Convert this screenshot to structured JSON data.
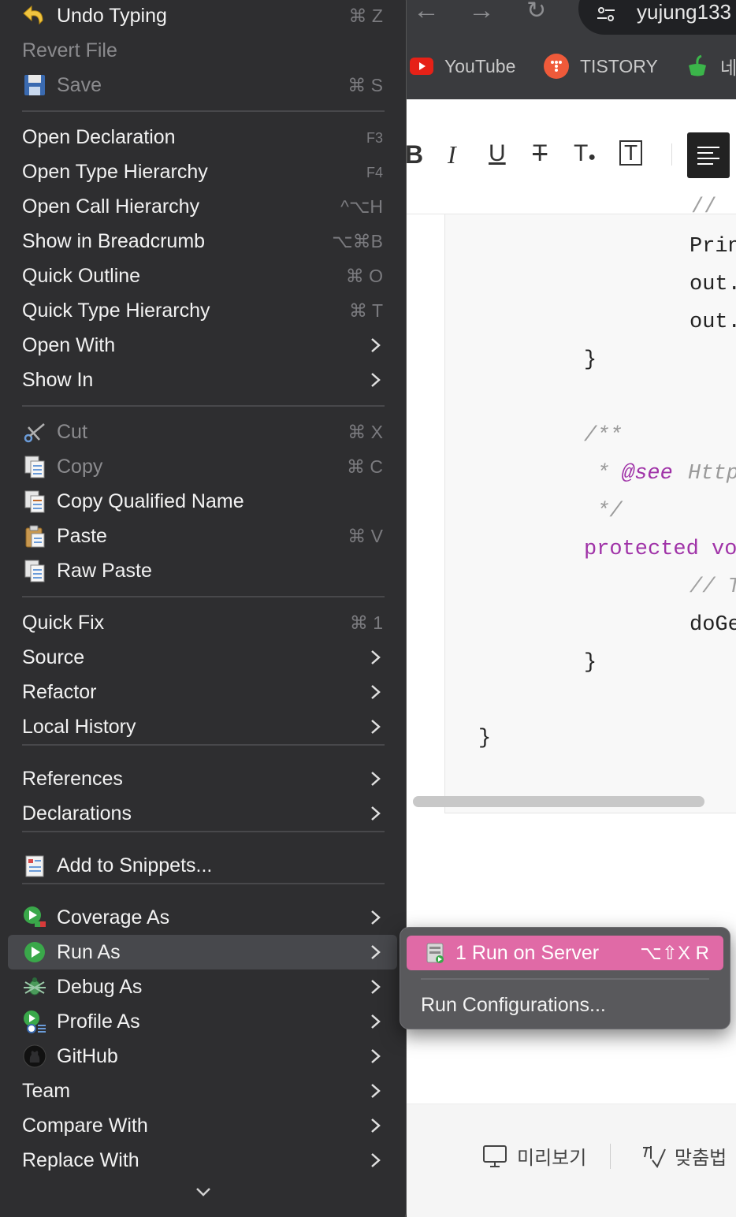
{
  "browser": {
    "url_text": "yujung133",
    "bookmarks": [
      {
        "label": "YouTube",
        "icon": "youtube-icon",
        "color": "#e62117"
      },
      {
        "label": "TISTORY",
        "icon": "tistory-icon",
        "color": "#ef5a3a"
      },
      {
        "label": "네",
        "icon": "naver-icon",
        "color": "#3bb54a"
      }
    ],
    "toolbar": [
      "B",
      "I",
      "U",
      "T",
      "T",
      "T"
    ],
    "code_lines": [
      {
        "text": "//",
        "color": "#a0a0a0"
      },
      {
        "text": "Prin",
        "color": "#222222"
      },
      {
        "text": "out.",
        "color": "#222222"
      },
      {
        "text": "out.",
        "color": "#222222"
      },
      {
        "text": "}",
        "color": "#222222"
      },
      {
        "text": "/**",
        "color": "#9a9a9a"
      },
      {
        "text": " * ",
        "color": "#9a9a9a"
      },
      {
        "text": "@see",
        "color": "#a033a8"
      },
      {
        "text": "Http",
        "color": "#9a9a9a"
      },
      {
        "text": " */",
        "color": "#9a9a9a"
      },
      {
        "text": "protected vo",
        "color": "#a033a8"
      },
      {
        "text": "// T",
        "color": "#a0a0a0"
      },
      {
        "text": "doGe",
        "color": "#222222"
      },
      {
        "text": "}",
        "color": "#222222"
      },
      {
        "text": "}",
        "color": "#222222"
      }
    ],
    "bottom_bar": {
      "preview": "미리보기",
      "spellcheck": "맞춤법"
    }
  },
  "menu": {
    "items": [
      {
        "label": "Undo Typing",
        "shortcut": "⌘ Z",
        "icon": "undo-icon",
        "disabled": false
      },
      {
        "label": "Revert File",
        "shortcut": "",
        "icon": "",
        "disabled": true
      },
      {
        "label": "Save",
        "shortcut": "⌘ S",
        "icon": "save-icon",
        "disabled": true
      },
      {
        "label": "Open Declaration",
        "shortcut": "F3",
        "icon": "",
        "disabled": false
      },
      {
        "label": "Open Type Hierarchy",
        "shortcut": "F4",
        "icon": "",
        "disabled": false
      },
      {
        "label": "Open Call Hierarchy",
        "shortcut": "^⌥H",
        "icon": "",
        "disabled": false
      },
      {
        "label": "Show in Breadcrumb",
        "shortcut": "⌥⌘B",
        "icon": "",
        "disabled": false
      },
      {
        "label": "Quick Outline",
        "shortcut": "⌘ O",
        "icon": "",
        "disabled": false
      },
      {
        "label": "Quick Type Hierarchy",
        "shortcut": "⌘ T",
        "icon": "",
        "disabled": false
      },
      {
        "label": "Open With",
        "submenu": true,
        "icon": "",
        "disabled": false
      },
      {
        "label": "Show In",
        "submenu": true,
        "icon": "",
        "disabled": false
      },
      {
        "label": "Cut",
        "shortcut": "⌘ X",
        "icon": "scissors-icon",
        "disabled": true
      },
      {
        "label": "Copy",
        "shortcut": "⌘ C",
        "icon": "copy-icon",
        "disabled": true
      },
      {
        "label": "Copy Qualified Name",
        "shortcut": "",
        "icon": "copy-qualified-name-icon",
        "disabled": false
      },
      {
        "label": "Paste",
        "shortcut": "⌘ V",
        "icon": "paste-icon",
        "disabled": false
      },
      {
        "label": "Raw Paste",
        "shortcut": "",
        "icon": "raw-paste-icon",
        "disabled": false
      },
      {
        "label": "Quick Fix",
        "shortcut": "⌘ 1",
        "icon": "",
        "disabled": false
      },
      {
        "label": "Source",
        "submenu": true,
        "icon": "",
        "disabled": false
      },
      {
        "label": "Refactor",
        "submenu": true,
        "icon": "",
        "disabled": false
      },
      {
        "label": "Local History",
        "submenu": true,
        "icon": "",
        "disabled": false
      },
      {
        "label": "References",
        "submenu": true,
        "icon": "",
        "disabled": false
      },
      {
        "label": "Declarations",
        "submenu": true,
        "icon": "",
        "disabled": false
      },
      {
        "label": "Add to Snippets...",
        "shortcut": "",
        "icon": "snippets-icon",
        "disabled": false
      },
      {
        "label": "Coverage As",
        "submenu": true,
        "icon": "coverage-icon",
        "disabled": false
      },
      {
        "label": "Run As",
        "submenu": true,
        "icon": "run-icon",
        "disabled": false,
        "highlighted": true
      },
      {
        "label": "Debug As",
        "submenu": true,
        "icon": "debug-bug-icon",
        "disabled": false
      },
      {
        "label": "Profile As",
        "submenu": true,
        "icon": "profile-icon",
        "disabled": false
      },
      {
        "label": "GitHub",
        "submenu": true,
        "icon": "github-icon",
        "disabled": false
      },
      {
        "label": "Team",
        "submenu": true,
        "icon": "",
        "disabled": false
      },
      {
        "label": "Compare With",
        "submenu": true,
        "icon": "",
        "disabled": false
      },
      {
        "label": "Replace With",
        "submenu": true,
        "icon": "",
        "disabled": false
      }
    ]
  },
  "submenu": {
    "items": [
      {
        "label": "1 Run on Server",
        "shortcut": "⌥⇧X R",
        "icon": "server-icon",
        "highlighted": true
      },
      {
        "label": "Run Configurations...",
        "shortcut": "",
        "icon": ""
      }
    ]
  },
  "colors": {
    "highlight": "#e06aa6",
    "menu_bg": "#2e2e30"
  }
}
